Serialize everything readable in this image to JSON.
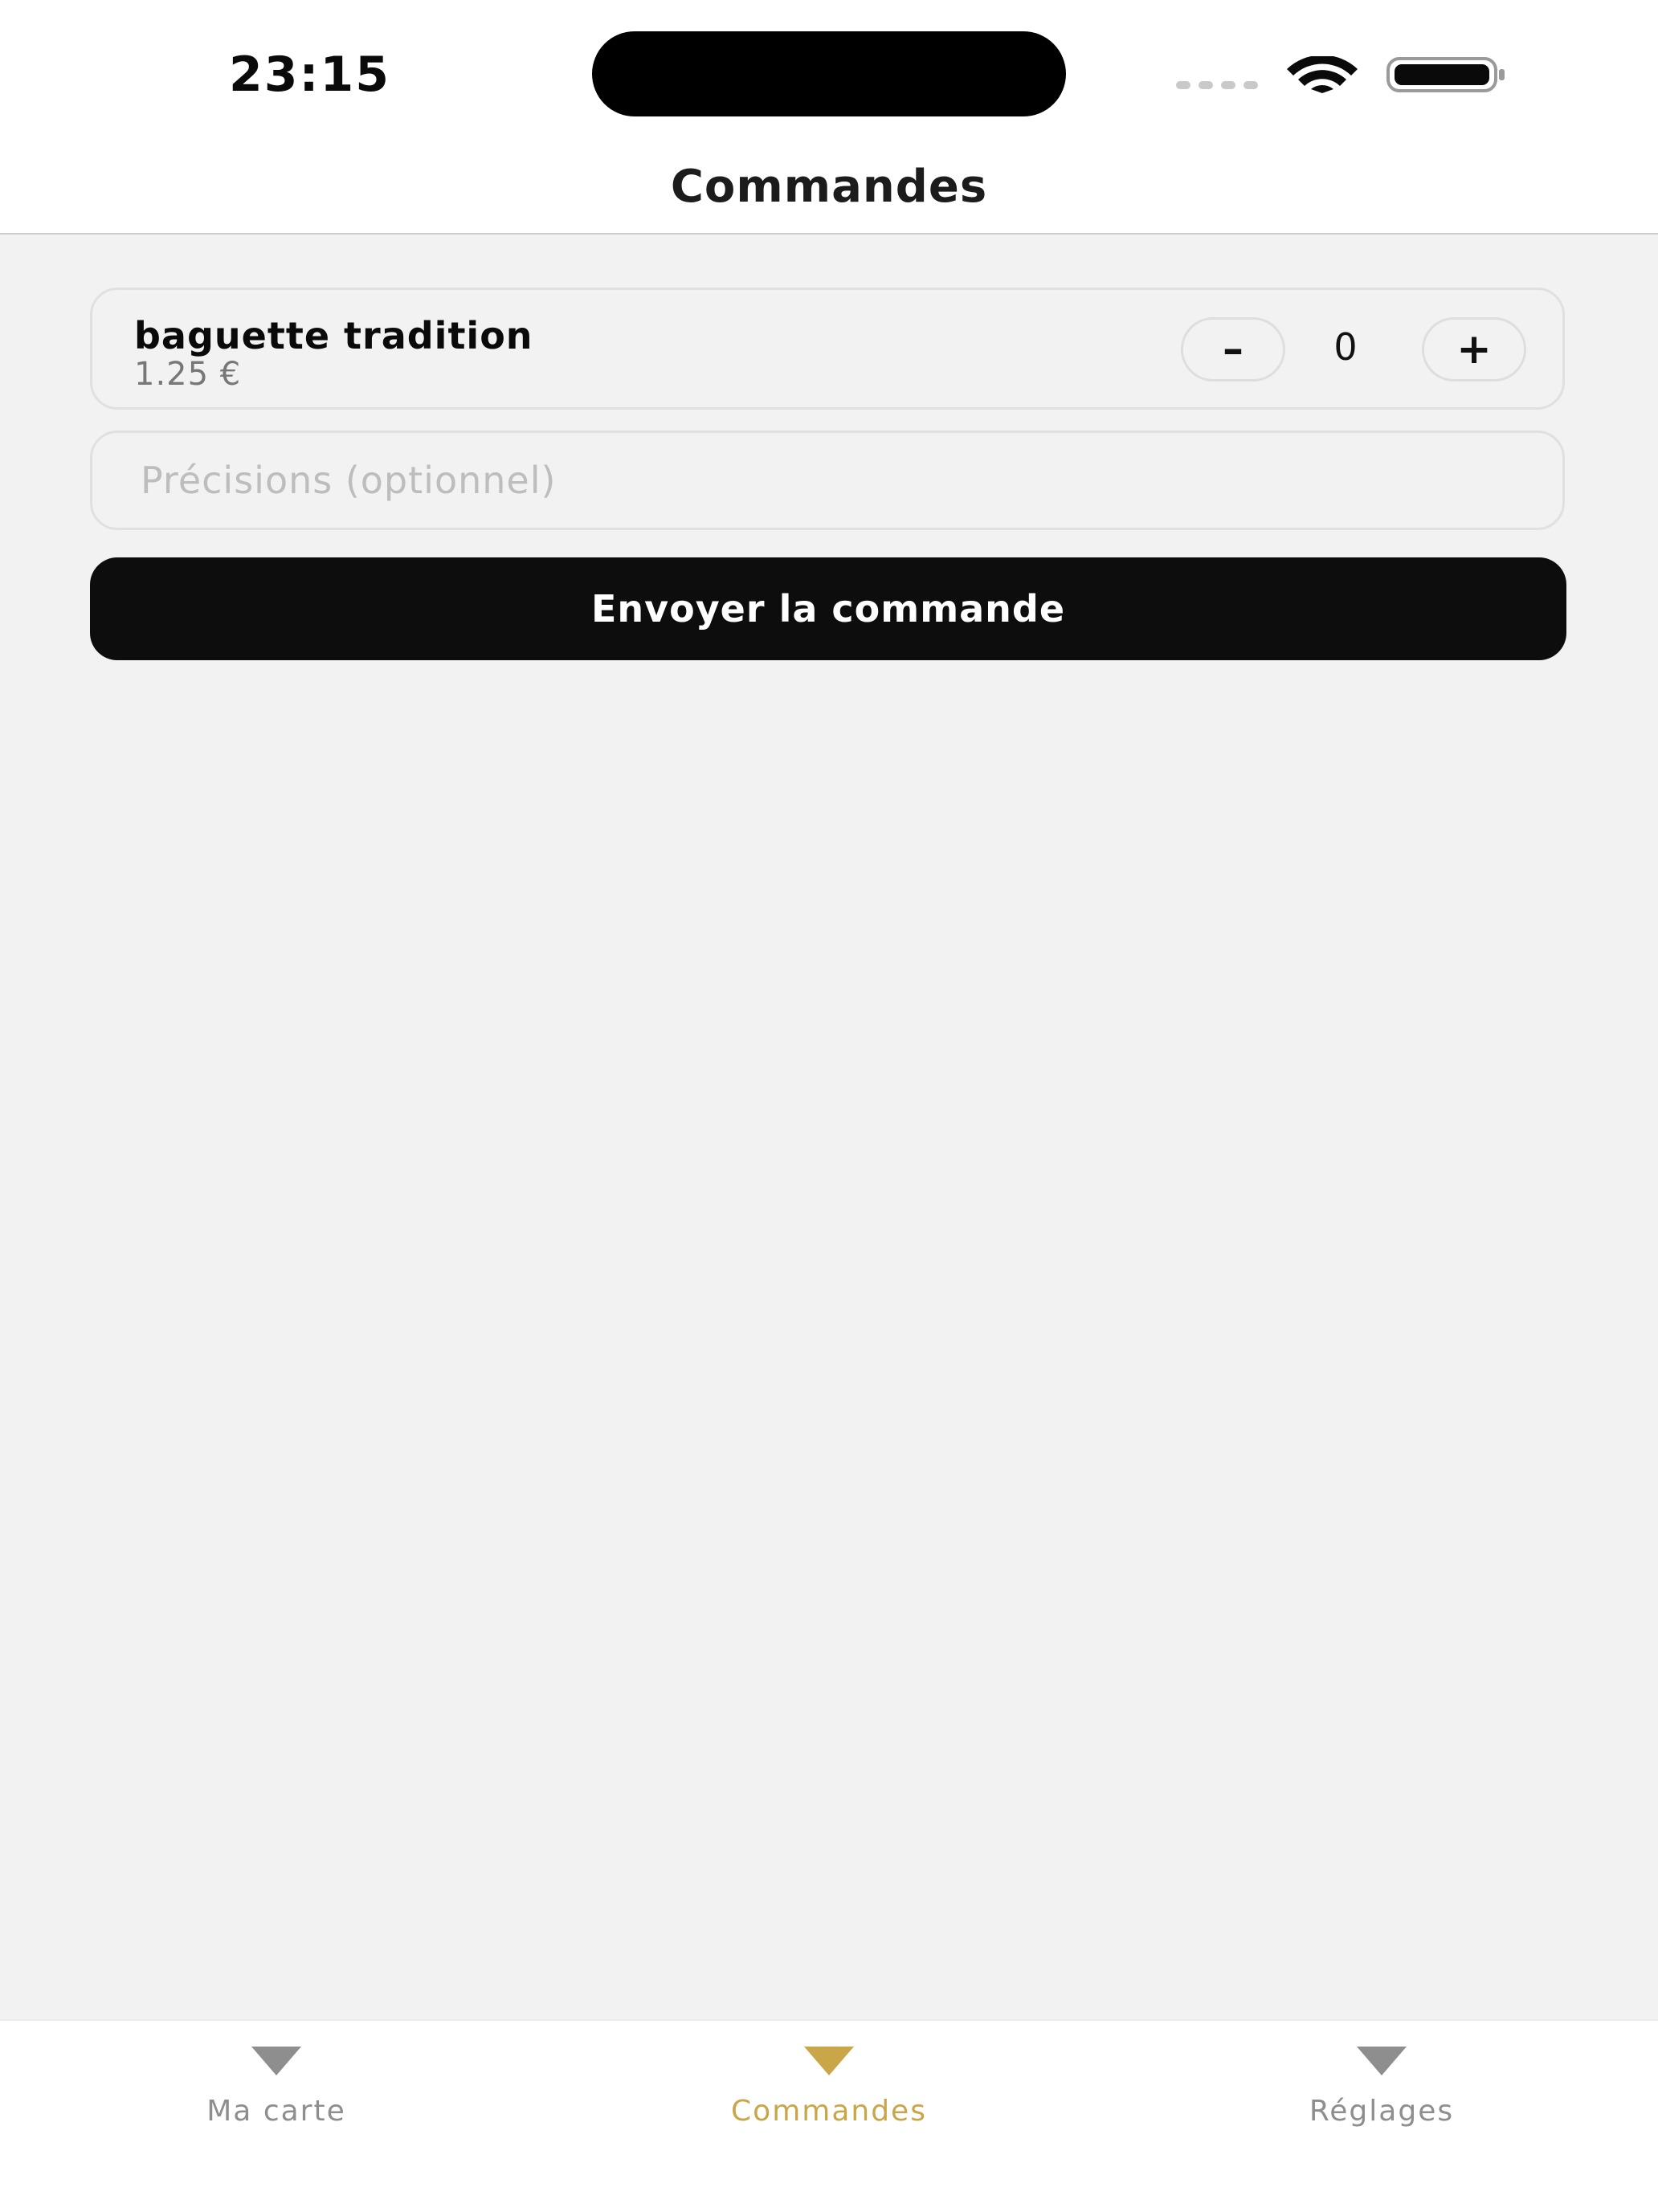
{
  "status_bar": {
    "time": "23:15",
    "icons": [
      "signal-icon",
      "wifi-icon",
      "battery-icon"
    ]
  },
  "nav": {
    "title": "Commandes"
  },
  "order_item": {
    "name": "baguette tradition",
    "price": "1.25 €",
    "quantity": "0",
    "decrement_label": "–",
    "increment_label": "+"
  },
  "notes": {
    "value": "",
    "placeholder": "Précisions (optionnel)"
  },
  "send_button": {
    "label": "Envoyer la commande"
  },
  "tabs": [
    {
      "label": "Ma carte",
      "icon": "triangle-down-icon",
      "active": false
    },
    {
      "label": "Commandes",
      "icon": "triangle-down-icon",
      "active": true
    },
    {
      "label": "Réglages",
      "icon": "triangle-down-icon",
      "active": false
    }
  ],
  "colors": {
    "accent": "#c9a748",
    "inactive_tab": "#8e8e8e",
    "button_bg": "#0d0d0d",
    "page_bg": "#f2f2f2"
  }
}
